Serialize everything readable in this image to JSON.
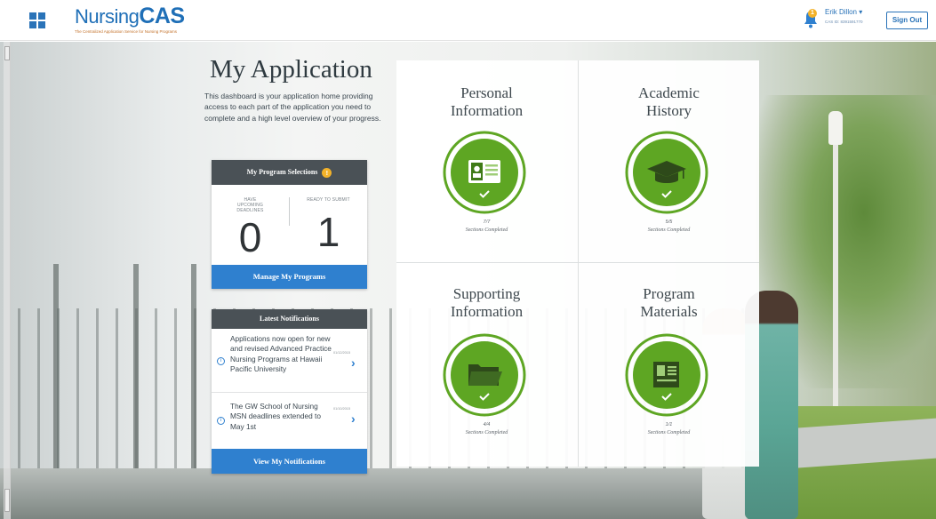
{
  "header": {
    "logo_prefix": "Nursing",
    "logo_suffix": "CAS",
    "logo_tagline": "The Centralized Application Service for Nursing Programs",
    "notification_count": "1",
    "user_name": "Erik Dillon",
    "user_id": "CAS ID: 8391591770",
    "signout_label": "Sign Out"
  },
  "page": {
    "title": "My Application",
    "description": "This dashboard is your application home providing access to each part of the application you need to complete and a high level overview of your progress."
  },
  "program_selections": {
    "title": "My Program Selections",
    "info_icon": "!",
    "left_label": "HAVE UPCOMING DEADLINES",
    "left_count": "0",
    "right_label": "READY TO SUBMIT",
    "right_count": "1",
    "button_label": "Manage My Programs"
  },
  "notifications": {
    "title": "Latest Notifications",
    "items": [
      {
        "text": "Applications now open for new and revised Advanced Practice Nursing Programs at Hawaii Pacific University",
        "date": "01/12/2015"
      },
      {
        "text": "The GW School of Nursing MSN deadlines extended to May 1st",
        "date": "01/10/2015"
      }
    ],
    "button_label": "View My Notifications"
  },
  "sections": [
    {
      "title_line1": "Personal",
      "title_line2": "Information",
      "count": "7/7",
      "label": "Sections Completed",
      "icon": "id-card-icon"
    },
    {
      "title_line1": "Academic",
      "title_line2": "History",
      "count": "5/5",
      "label": "Sections Completed",
      "icon": "graduation-cap-icon"
    },
    {
      "title_line1": "Supporting",
      "title_line2": "Information",
      "count": "4/4",
      "label": "Sections Completed",
      "icon": "folder-icon"
    },
    {
      "title_line1": "Program",
      "title_line2": "Materials",
      "count": "1/1",
      "label": "Sections Completed",
      "icon": "book-icon"
    }
  ],
  "colors": {
    "brand_blue": "#2f80cf",
    "progress_green": "#5ea623",
    "header_dark": "#4a5156",
    "accent_yellow": "#f3b22a"
  }
}
